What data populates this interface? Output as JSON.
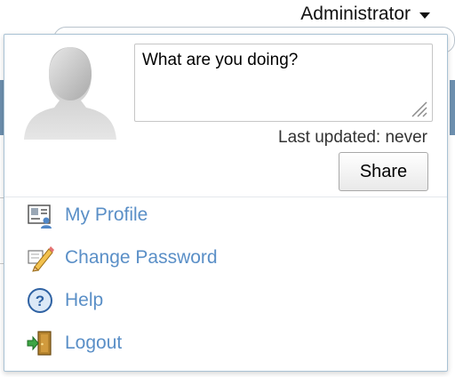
{
  "header": {
    "user_name": "Administrator"
  },
  "profile_panel": {
    "status_placeholder": "What are you doing?",
    "last_updated": "Last updated: never",
    "share_label": "Share"
  },
  "menu": [
    {
      "label": "My Profile",
      "icon": "profile-card-icon"
    },
    {
      "label": "Change Password",
      "icon": "pencil-icon"
    },
    {
      "label": "Help",
      "icon": "help-icon"
    },
    {
      "label": "Logout",
      "icon": "logout-icon"
    }
  ],
  "colors": {
    "link": "#5a8fc7",
    "border": "#a9c2d4"
  }
}
